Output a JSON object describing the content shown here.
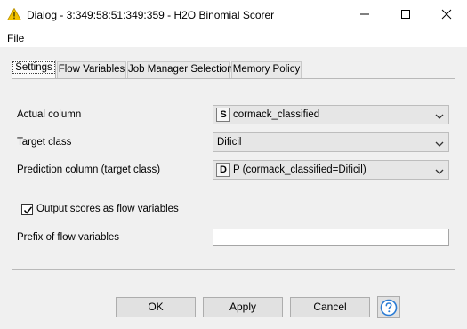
{
  "window": {
    "title": "Dialog - 3:349:58:51:349:359 - H2O Binomial Scorer",
    "icon": "warning-triangle-icon",
    "title_bar_bg": "#ffffff"
  },
  "menu": {
    "file_label": "File"
  },
  "tabs": [
    {
      "label": "Settings",
      "active": true
    },
    {
      "label": "Flow Variables",
      "active": false
    },
    {
      "label": "Job Manager Selection",
      "active": false
    },
    {
      "label": "Memory Policy",
      "active": false
    }
  ],
  "settings": {
    "actual_column": {
      "label": "Actual column",
      "type_badge": "S",
      "value": "cormack_classified"
    },
    "target_class": {
      "label": "Target class",
      "value": "Dificil"
    },
    "prediction_column": {
      "label": "Prediction column (target class)",
      "type_badge": "D",
      "value": "P (cormack_classified=Dificil)"
    },
    "output_scores": {
      "label": "Output scores as flow variables",
      "checked": true
    },
    "prefix": {
      "label": "Prefix of flow variables",
      "value": ""
    }
  },
  "buttons": {
    "ok": "OK",
    "apply": "Apply",
    "cancel": "Cancel",
    "help_icon": "help-question-icon"
  },
  "colors": {
    "help_icon": "#2a7bd4",
    "title_icon": "#f3c200"
  }
}
